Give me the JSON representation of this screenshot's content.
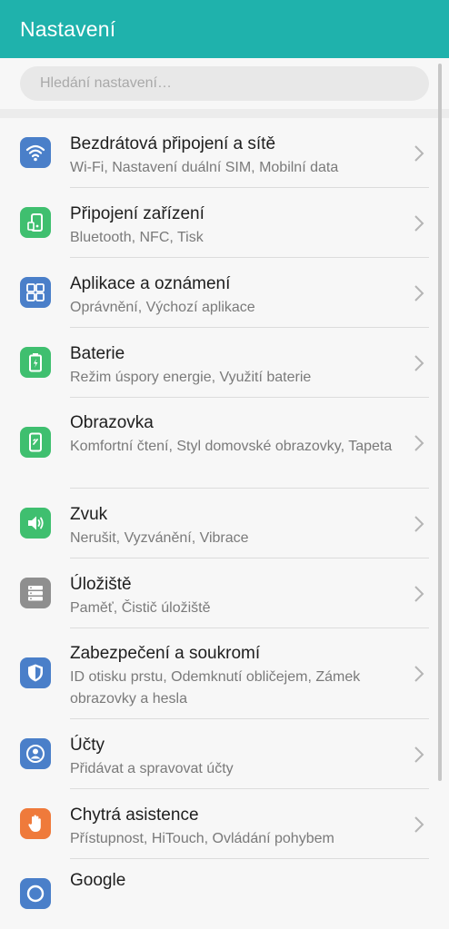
{
  "header": {
    "title": "Nastavení",
    "color": "#1fb2ac"
  },
  "search": {
    "placeholder": "Hledání nastavení…"
  },
  "items": [
    {
      "title": "Bezdrátová připojení a sítě",
      "subtitle": "Wi-Fi, Nastavení duální SIM, Mobilní data",
      "icon": "wifi-icon",
      "color": "#4a7fc9"
    },
    {
      "title": "Připojení zařízení",
      "subtitle": "Bluetooth, NFC, Tisk",
      "icon": "device-connection-icon",
      "color": "#3fbf6f"
    },
    {
      "title": "Aplikace a oznámení",
      "subtitle": "Oprávnění, Výchozí aplikace",
      "icon": "apps-icon",
      "color": "#4a7fc9"
    },
    {
      "title": "Baterie",
      "subtitle": "Režim úspory energie, Využití baterie",
      "icon": "battery-icon",
      "color": "#3fbf6f"
    },
    {
      "title": "Obrazovka",
      "subtitle": "Komfortní čtení, Styl domovské obrazovky, Tapeta",
      "icon": "display-icon",
      "color": "#3fbf6f"
    },
    {
      "title": "Zvuk",
      "subtitle": "Nerušit, Vyzvánění, Vibrace",
      "icon": "sound-icon",
      "color": "#3fbf6f"
    },
    {
      "title": "Úložiště",
      "subtitle": "Paměť, Čistič úložiště",
      "icon": "storage-icon",
      "color": "#8f8f8f"
    },
    {
      "title": "Zabezpečení a soukromí",
      "subtitle": "ID otisku prstu, Odemknutí obličejem, Zámek obrazovky a hesla",
      "icon": "shield-icon",
      "color": "#4a7fc9"
    },
    {
      "title": "Účty",
      "subtitle": "Přidávat a spravovat účty",
      "icon": "account-icon",
      "color": "#4a7fc9"
    },
    {
      "title": "Chytrá asistence",
      "subtitle": "Přístupnost, HiTouch, Ovládání pohybem",
      "icon": "hand-icon",
      "color": "#ef7a3b"
    },
    {
      "title": "Google",
      "subtitle": "",
      "icon": "google-icon",
      "color": "#4a7fc9"
    }
  ]
}
